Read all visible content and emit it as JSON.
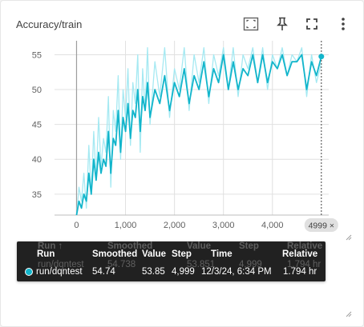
{
  "card": {
    "title": "Accuracy/train"
  },
  "toolbar": {
    "icons": [
      "fit-domain-icon",
      "pin-icon",
      "fullscreen-icon",
      "more-vert-icon"
    ]
  },
  "colors": {
    "raw_line": "#a5e9f2",
    "smoothed_line": "#12b5cb",
    "grid": "#e0e0e0",
    "axis_text": "#616161"
  },
  "chart_data": {
    "type": "line",
    "title": "Accuracy/train",
    "xlim": [
      -450,
      5150
    ],
    "ylim": [
      32,
      57
    ],
    "xticks": [
      0,
      1000,
      2000,
      3000,
      4000
    ],
    "xtick_labels": [
      "0",
      "1,000",
      "2,000",
      "3,000",
      "4,000"
    ],
    "yticks": [
      35,
      40,
      45,
      50,
      55
    ],
    "ytick_labels": [
      "35",
      "40",
      "45",
      "50",
      "55"
    ],
    "grid": true,
    "cursor_step": 4999,
    "cursor_label": "4999 ×",
    "series": [
      {
        "name": "run/dqntest",
        "smoothing": "raw",
        "x": [
          0,
          50,
          100,
          150,
          200,
          250,
          300,
          350,
          400,
          450,
          500,
          550,
          600,
          650,
          700,
          750,
          800,
          850,
          900,
          950,
          1000,
          1050,
          1100,
          1150,
          1200,
          1250,
          1300,
          1350,
          1400,
          1450,
          1500,
          1600,
          1700,
          1800,
          1900,
          2000,
          2100,
          2200,
          2300,
          2400,
          2500,
          2600,
          2700,
          2800,
          2900,
          3000,
          3100,
          3200,
          3300,
          3400,
          3500,
          3600,
          3700,
          3800,
          3900,
          4000,
          4100,
          4200,
          4300,
          4400,
          4500,
          4600,
          4700,
          4800,
          4900,
          4999
        ],
        "y": [
          32,
          36,
          34,
          38,
          33,
          42,
          35,
          44,
          37,
          46,
          39,
          43,
          41,
          49,
          36,
          47,
          44,
          52,
          40,
          50,
          46,
          53,
          42,
          51,
          48,
          55,
          41,
          53,
          47,
          56,
          45,
          54,
          49,
          56,
          46,
          53,
          50,
          56,
          47,
          55,
          51,
          56,
          48,
          55,
          52,
          56,
          50,
          56,
          49,
          55,
          53,
          56,
          51,
          56,
          50,
          55,
          53,
          56,
          52,
          55,
          54,
          56,
          49,
          55,
          51,
          53.85
        ]
      },
      {
        "name": "run/dqntest",
        "smoothing": "smoothed",
        "x": [
          0,
          50,
          100,
          150,
          200,
          250,
          300,
          350,
          400,
          450,
          500,
          550,
          600,
          650,
          700,
          750,
          800,
          850,
          900,
          950,
          1000,
          1050,
          1100,
          1150,
          1200,
          1250,
          1300,
          1350,
          1400,
          1450,
          1500,
          1600,
          1700,
          1800,
          1900,
          2000,
          2100,
          2200,
          2300,
          2400,
          2500,
          2600,
          2700,
          2800,
          2900,
          3000,
          3100,
          3200,
          3300,
          3400,
          3500,
          3600,
          3700,
          3800,
          3900,
          4000,
          4100,
          4200,
          4300,
          4400,
          4500,
          4600,
          4700,
          4800,
          4900,
          4999
        ],
        "y": [
          32,
          34,
          33,
          35,
          34,
          38,
          35,
          40,
          37,
          41,
          38,
          40,
          39,
          44,
          38,
          43,
          42,
          47,
          41,
          46,
          44,
          48,
          43,
          47,
          46,
          50,
          44,
          49,
          47,
          51,
          46,
          50,
          48,
          52,
          47,
          51,
          49,
          53,
          48,
          52,
          50,
          54,
          49,
          53,
          51,
          55,
          50,
          54,
          50,
          53,
          52,
          55,
          51,
          55,
          51,
          54,
          53,
          55,
          52,
          54,
          54,
          55,
          50,
          54,
          52,
          54.74
        ]
      }
    ]
  },
  "tooltip": {
    "ghost_headers": [
      "Run ↑",
      "Smoothed",
      "Value",
      "Step",
      "Relative"
    ],
    "ghost_row": [
      "run/dqntest",
      "54.738",
      "53.851",
      "4,999",
      "1.794 hr"
    ],
    "headers": [
      "Run",
      "Smoothed",
      "Value",
      "Step",
      "Time",
      "Relative"
    ],
    "row": {
      "run": "run/dqntest",
      "smoothed": "54.74",
      "value": "53.85",
      "step": "4,999",
      "time": "12/3/24, 6:34 PM",
      "relative": "1.794 hr"
    }
  }
}
